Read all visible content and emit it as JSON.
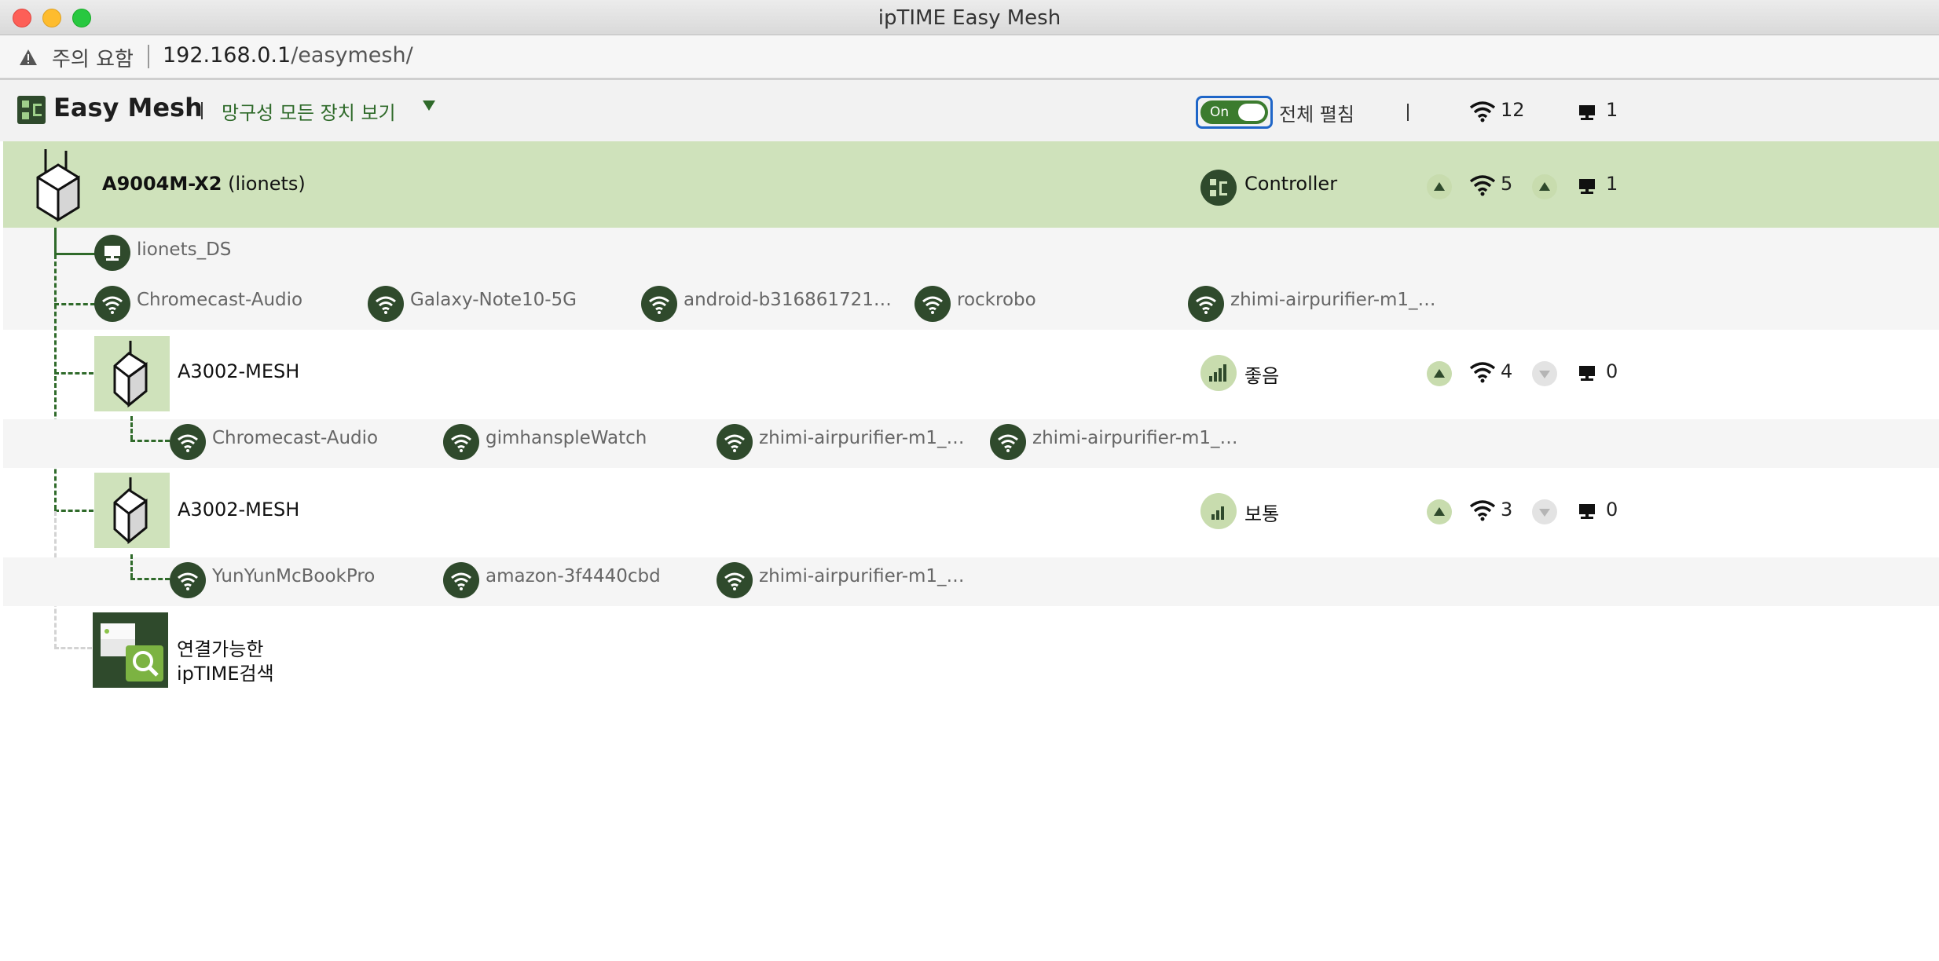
{
  "window": {
    "title": "ipTIME Easy Mesh"
  },
  "address_bar": {
    "warning": "주의 요함",
    "host": "192.168.0.1",
    "path": "/easymesh/"
  },
  "header": {
    "app_title": "Easy Mesh",
    "view_all": "망구성 모든 장치 보기",
    "toggle_label": "On",
    "expand_all": "전체 펼침",
    "wifi_count": "12",
    "wired_count": "1"
  },
  "controller": {
    "model": "A9004M-X2",
    "name": "(lionets)",
    "role": "Controller",
    "wifi_count": "5",
    "wired_count": "1",
    "wired_clients": [
      "lionets_DS"
    ],
    "wifi_clients": [
      "Chromecast-Audio",
      "Galaxy-Note10-5G",
      "android-b316861721…",
      "rockrobo",
      "zhimi-airpurifier-m1_…"
    ]
  },
  "mesh_nodes": [
    {
      "name": "A3002-MESH",
      "signal": "좋음",
      "wifi_count": "4",
      "wired_count": "0",
      "wifi_clients": [
        "Chromecast-Audio",
        "gimhanspleWatch",
        "zhimi-airpurifier-m1_…",
        "zhimi-airpurifier-m1_…"
      ]
    },
    {
      "name": "A3002-MESH",
      "signal": "보통",
      "wifi_count": "3",
      "wired_count": "0",
      "wifi_clients": [
        "YunYunMcBookPro",
        "amazon-3f4440cbd",
        "zhimi-airpurifier-m1_…"
      ]
    }
  ],
  "search": {
    "line1": "연결가능한",
    "line2": "ipTIME검색"
  },
  "colors": {
    "accent_dark": "#2f4a2c",
    "accent_green": "#3b7b2e",
    "highlight_row": "#cfe2bb",
    "focus_blue": "#1f66c8"
  },
  "icons": [
    "warning-icon",
    "easymesh-logo-icon",
    "wifi-icon",
    "monitor-icon",
    "router-icon",
    "signal-bars-icon",
    "controller-icon",
    "search-icon"
  ]
}
